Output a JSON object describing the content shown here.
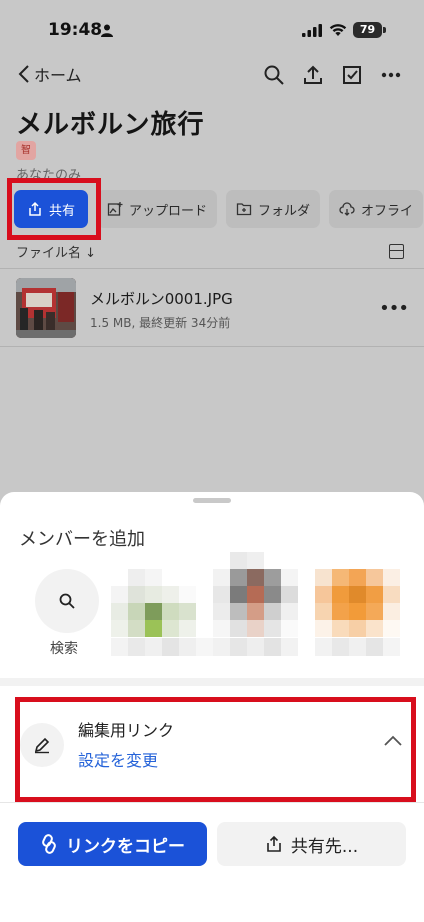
{
  "status": {
    "time": "19:48",
    "battery": "79"
  },
  "nav": {
    "back_label": "ホーム",
    "icons": [
      "search-icon",
      "upload-icon",
      "select-checkbox-icon",
      "more-icon"
    ]
  },
  "folder": {
    "title": "メルボルン旅行",
    "avatar_initial": "智",
    "owner_text": "あなたのみ"
  },
  "actions": {
    "share": "共有",
    "upload": "アップロード",
    "folder": "フォルダ",
    "offline": "オフライ"
  },
  "sort": {
    "label": "ファイル名"
  },
  "file": {
    "name": "メルボルン0001.JPG",
    "meta": "1.5 MB, 最終更新 34分前"
  },
  "sheet": {
    "title": "メンバーを追加",
    "search_label": "検索",
    "link_title": "編集用リンク",
    "link_sub": "設定を変更",
    "copy_button": "リンクをコピー",
    "share_to_button": "共有先..."
  },
  "colors": {
    "accent": "#1b52d8",
    "highlight": "#d80e1d",
    "link": "#2563d9"
  }
}
